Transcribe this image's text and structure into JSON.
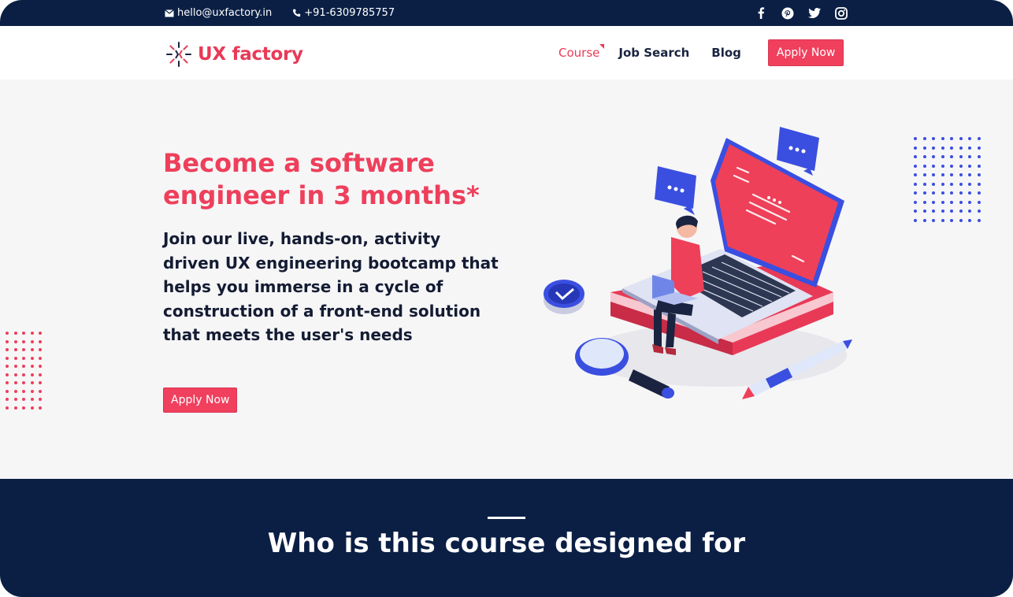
{
  "topbar": {
    "email": "hello@uxfactory.in",
    "phone": "+91-6309785757",
    "social": [
      "facebook-icon",
      "pinterest-icon",
      "twitter-icon",
      "instagram-icon"
    ]
  },
  "nav": {
    "logo_text": "UX factory",
    "items": [
      {
        "label": "Course",
        "active": true
      },
      {
        "label": "Job Search"
      },
      {
        "label": "Blog"
      }
    ],
    "apply_label": "Apply Now"
  },
  "hero": {
    "title": "Become a software engineer in 3 months*",
    "description": "Join our live, hands-on, activity driven UX engineering bootcamp that helps you immerse in a cycle of construction of a front-end solution that meets the user's needs",
    "cta_label": "Apply Now"
  },
  "section": {
    "title": "Who is this course designed for"
  },
  "colors": {
    "brand_red": "#ee3f5b",
    "navy": "#0b1f45",
    "blue": "#3a4fe0",
    "hero_bg": "#f6f6f7"
  }
}
